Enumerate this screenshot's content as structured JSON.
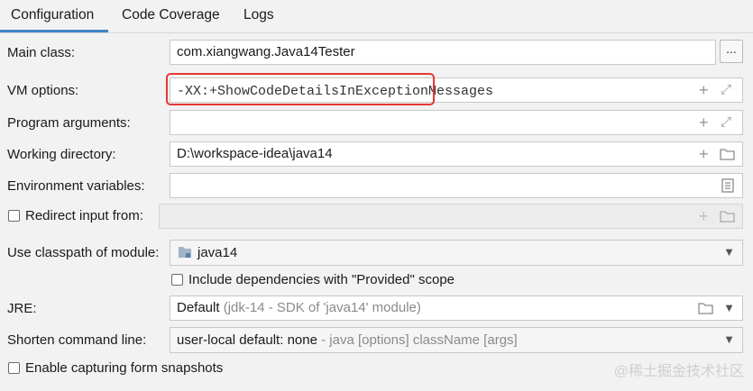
{
  "tabs": [
    "Configuration",
    "Code Coverage",
    "Logs"
  ],
  "form": {
    "main_class": {
      "label": "Main class:",
      "value": "com.xiangwang.Java14Tester",
      "browse": "..."
    },
    "vm_options": {
      "label": "VM options:",
      "value": "-XX:+ShowCodeDetailsInExceptionMessages"
    },
    "program_arguments": {
      "label": "Program arguments:",
      "value": ""
    },
    "working_directory": {
      "label": "Working directory:",
      "value": "D:\\workspace-idea\\java14"
    },
    "environment_variables": {
      "label": "Environment variables:",
      "value": ""
    },
    "redirect_input": {
      "label": "Redirect input from:",
      "checked": false,
      "value": ""
    },
    "classpath_module": {
      "label": "Use classpath of module:",
      "value": "java14"
    },
    "include_provided": {
      "label": "Include dependencies with \"Provided\" scope",
      "checked": false
    },
    "jre": {
      "label": "JRE:",
      "value": "Default",
      "hint": "(jdk-14 - SDK of 'java14' module)"
    },
    "shorten_command_line": {
      "label": "Shorten command line:",
      "value": "user-local default: none",
      "hint": "- java [options] className [args]"
    },
    "capture_snapshots": {
      "label": "Enable capturing form snapshots",
      "checked": false
    }
  },
  "watermark": "@稀土掘金技术社区",
  "colors": {
    "tab_underline": "#4083c9",
    "highlight": "#e53935"
  },
  "icons": {
    "add": "+",
    "expand": "⤢",
    "folder": "folder-icon",
    "doc": "document-icon",
    "chevron": "⌄"
  }
}
